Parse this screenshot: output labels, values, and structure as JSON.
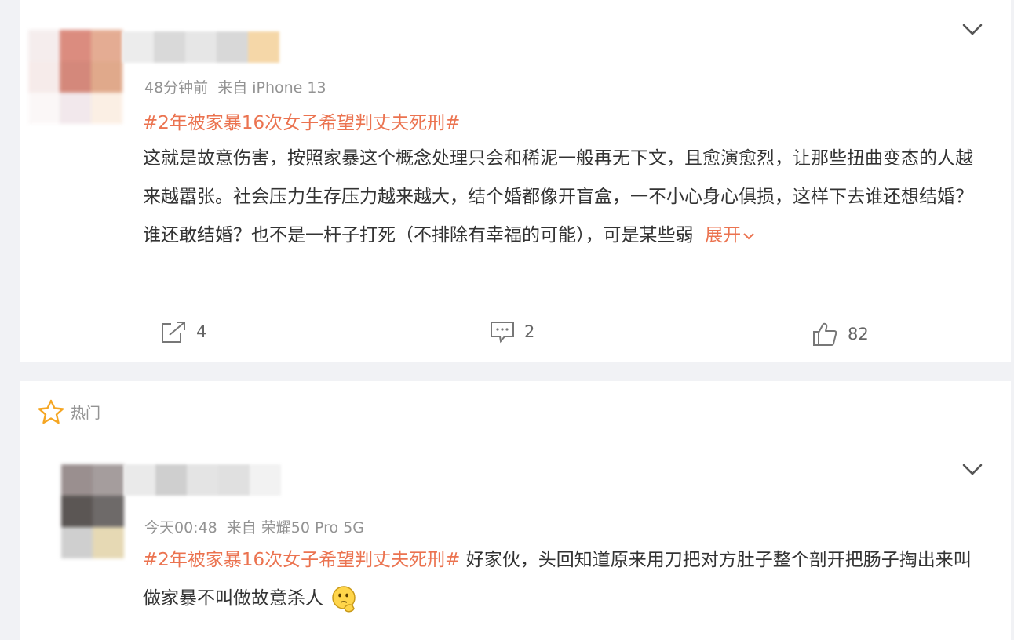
{
  "comment1": {
    "time": "48分钟前",
    "source": "来自 iPhone 13",
    "topic": "#2年被家暴16次女子希望判丈夫死刑#",
    "body": "这就是故意伤害，按照家暴这个概念处理只会和稀泥一般再无下文，且愈演愈烈，让那些扭曲变态的人越来越嚣张。社会压力生存压力越来越大，结个婚都像开盲盒，一不小心身心俱损，这样下去谁还想结婚？谁还敢结婚？也不是一杆子打死（不排除有幸福的可能），可是某些弱",
    "expand_label": "展开",
    "repost_count": "4",
    "comment_count": "2",
    "like_count": "82"
  },
  "hot_label": "热门",
  "comment2": {
    "time": "今天00:48",
    "source": "来自 荣耀50 Pro 5G",
    "topic": "#2年被家暴16次女子希望判丈夫死刑#",
    "body": " 好家伙，头回知道原来用刀把对方肚子整个剖开把肠子掏出来叫做家暴不叫做故意杀人",
    "emoji": "thinking-emoji"
  },
  "colors": {
    "accent": "#eb7350",
    "hot_star": "#f5a623",
    "meta_gray": "#939393",
    "background": "#f1f2f5"
  }
}
